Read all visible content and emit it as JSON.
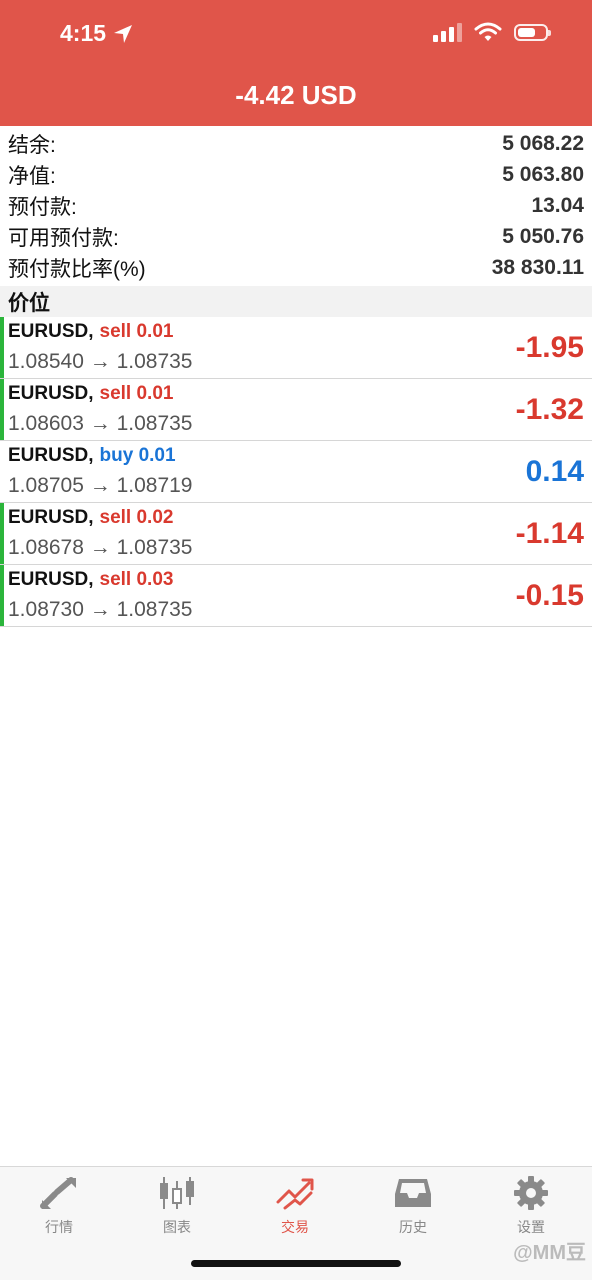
{
  "status_bar": {
    "time": "4:15"
  },
  "header": {
    "title": "-4.42 USD"
  },
  "summary": [
    {
      "label": "结余:",
      "value": "5 068.22"
    },
    {
      "label": "净值:",
      "value": "5 063.80"
    },
    {
      "label": "预付款:",
      "value": "13.04"
    },
    {
      "label": "可用预付款:",
      "value": "5 050.76"
    },
    {
      "label": "预付款比率(%)",
      "value": "38 830.11"
    }
  ],
  "section": {
    "title": "价位"
  },
  "positions": [
    {
      "symbol": "EURUSD,",
      "side": "sell 0.01",
      "prices": "1.08540 → 1.08735",
      "profit": "-1.95"
    },
    {
      "symbol": "EURUSD,",
      "side": "sell 0.01",
      "prices": "1.08603 → 1.08735",
      "profit": "-1.32"
    },
    {
      "symbol": "EURUSD,",
      "side": "buy 0.01",
      "prices": "1.08705 → 1.08719",
      "profit": "0.14"
    },
    {
      "symbol": "EURUSD,",
      "side": "sell 0.02",
      "prices": "1.08678 → 1.08735",
      "profit": "-1.14"
    },
    {
      "symbol": "EURUSD,",
      "side": "sell 0.03",
      "prices": "1.08730 → 1.08735",
      "profit": "-0.15"
    }
  ],
  "tabs": [
    {
      "label": "行情",
      "icon": "quotes-arrows-icon"
    },
    {
      "label": "图表",
      "icon": "candlestick-chart-icon"
    },
    {
      "label": "交易",
      "icon": "trade-trend-icon"
    },
    {
      "label": "历史",
      "icon": "history-inbox-icon"
    },
    {
      "label": "设置",
      "icon": "gear-icon"
    }
  ],
  "colors": {
    "header": "#e0554a",
    "sell": "#d9392e",
    "buy": "#1a74d6",
    "marker": "#2bb53b"
  },
  "watermark": "@MM豆"
}
